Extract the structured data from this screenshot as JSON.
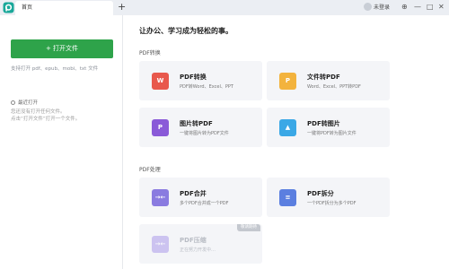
{
  "titlebar": {
    "tab_label": "首页",
    "new_tab": "+",
    "user_label": "未登录",
    "win_buttons": [
      "⊕",
      "—",
      "□",
      "✕"
    ]
  },
  "sidebar": {
    "open_button": "+ 打开文件",
    "support_text": "支持打开 pdf、epub、mobi、txt 文件",
    "recent_title": "最近打开",
    "recent_empty_line1": "您还没有打开任何文件。",
    "recent_empty_line2": "点击“打开文件”打开一个文件。"
  },
  "main": {
    "greeting": "让办公、学习成为轻松的事。",
    "sections": [
      {
        "title": "PDF转换",
        "cards": [
          {
            "title": "PDF转换",
            "desc": "PDF转Word、Excel、PPT",
            "icon_text": "W",
            "color": "#e8584c",
            "icon": "pdf-convert-icon"
          },
          {
            "title": "文件转PDF",
            "desc": "Word、Excel、PPT转PDF",
            "icon_text": "P",
            "color": "#f3b33d",
            "icon": "file-to-pdf-icon"
          },
          {
            "title": "图片转PDF",
            "desc": "一键将图片转为PDF文件",
            "icon_text": "P",
            "color": "#8a5ad8",
            "icon": "image-to-pdf-icon"
          },
          {
            "title": "PDF转图片",
            "desc": "一键将PDF转为图片文件",
            "icon_text": "▲",
            "color": "#3ba8e6",
            "icon": "pdf-to-image-icon"
          }
        ]
      },
      {
        "title": "PDF处理",
        "cards": [
          {
            "title": "PDF合并",
            "desc": "多个PDF合并成一个PDF",
            "icon_text": "→←",
            "color": "#8a7be0",
            "icon": "pdf-merge-icon"
          },
          {
            "title": "PDF拆分",
            "desc": "一个PDF拆分为多个PDF",
            "icon_text": "≡",
            "color": "#5b7fe0",
            "icon": "pdf-split-icon"
          },
          {
            "title": "PDF压缩",
            "desc": "正在努力开发中…",
            "icon_text": "→←",
            "color": "#9c88e8",
            "icon": "pdf-compress-icon",
            "badge": "敬请期待"
          }
        ]
      }
    ]
  }
}
